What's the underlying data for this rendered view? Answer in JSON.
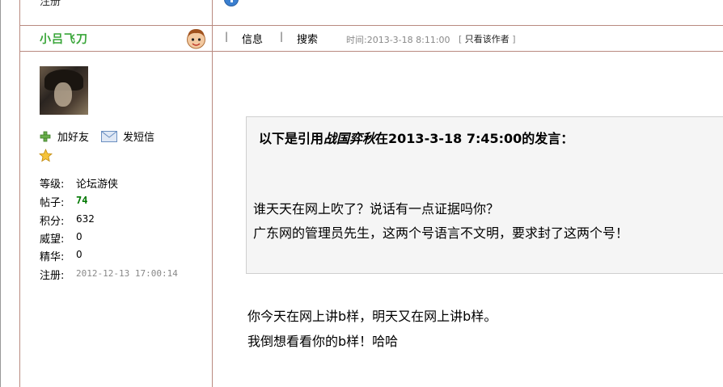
{
  "top_row": {
    "label": "注册",
    "icon": "info-icon"
  },
  "author": {
    "name": "小吕飞刀",
    "gender_icon": "male-avatar-icon"
  },
  "post_nav": {
    "info": "信息",
    "search": "搜索",
    "time": "时间:2013-3-18 8:11:00",
    "view_author_prefix": "[",
    "view_author": "只看该作者",
    "view_author_suffix": "]"
  },
  "profile": {
    "avatar_icon": "user-avatar",
    "add_friend": "加好友",
    "send_message": "发短信",
    "stats": [
      {
        "label": "等级:",
        "value": "论坛游侠"
      },
      {
        "label": "帖子:",
        "value": "74"
      },
      {
        "label": "积分:",
        "value": "632"
      },
      {
        "label": "威望:",
        "value": "0"
      },
      {
        "label": "精华:",
        "value": "0"
      },
      {
        "label": "注册:",
        "value": "2012-12-13 17:00:14"
      }
    ]
  },
  "quote": {
    "prefix": "以下是引用",
    "author": "战国弈秋",
    "suffix": "在2013-3-18 7:45:00的发言：",
    "lines": [
      "谁天天在网上吹了？说话有一点证据吗你？",
      " 广东网的管理员先生，这两个号语言不文明，要求封了这两个号！"
    ]
  },
  "post_body": [
    "你今天在网上讲b样，明天又在网上讲b样。",
    "我倒想看看你的b样！哈哈"
  ],
  "colors": {
    "border": "#b98a80",
    "author_name": "#3aa63a",
    "posts_value": "#007700",
    "quote_bg": "#f5f5f5"
  }
}
